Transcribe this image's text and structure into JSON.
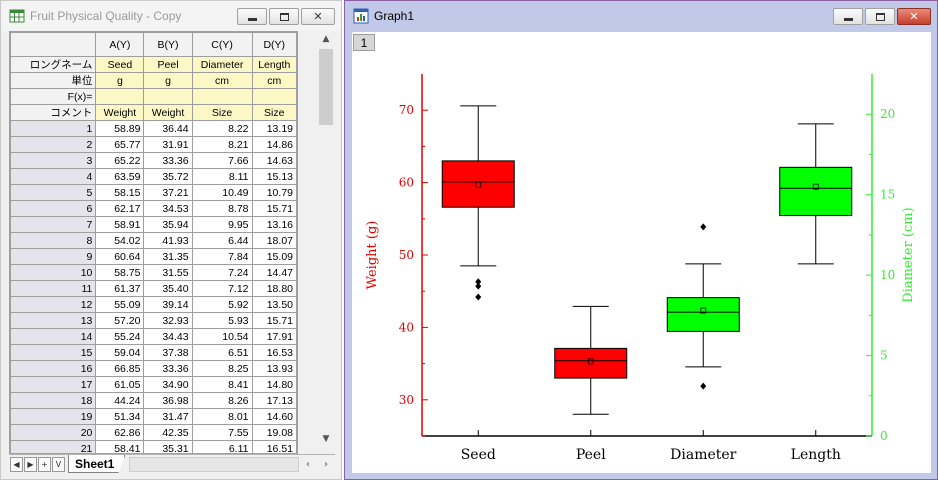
{
  "worksheet": {
    "title": "Fruit Physical Quality - Copy",
    "columns": [
      "A(Y)",
      "B(Y)",
      "C(Y)",
      "D(Y)"
    ],
    "meta_rows": [
      {
        "label": "ロングネーム",
        "values": [
          "Seed",
          "Peel",
          "Diameter",
          "Length"
        ]
      },
      {
        "label": "単位",
        "values": [
          "g",
          "g",
          "cm",
          "cm"
        ]
      },
      {
        "label": "F(x)=",
        "values": [
          "",
          "",
          "",
          ""
        ]
      },
      {
        "label": "コメント",
        "values": [
          "Weight",
          "Weight",
          "Size",
          "Size"
        ]
      }
    ],
    "rows": [
      [
        "1",
        "58.89",
        "36.44",
        "8.22",
        "13.19"
      ],
      [
        "2",
        "65.77",
        "31.91",
        "8.21",
        "14.86"
      ],
      [
        "3",
        "65.22",
        "33.36",
        "7.66",
        "14.63"
      ],
      [
        "4",
        "63.59",
        "35.72",
        "8.11",
        "15.13"
      ],
      [
        "5",
        "58.15",
        "37.21",
        "10.49",
        "10.79"
      ],
      [
        "6",
        "62.17",
        "34.53",
        "8.78",
        "15.71"
      ],
      [
        "7",
        "58.91",
        "35.94",
        "9.95",
        "13.16"
      ],
      [
        "8",
        "54.02",
        "41.93",
        "6.44",
        "18.07"
      ],
      [
        "9",
        "60.64",
        "31.35",
        "7.84",
        "15.09"
      ],
      [
        "10",
        "58.75",
        "31.55",
        "7.24",
        "14.47"
      ],
      [
        "11",
        "61.37",
        "35.40",
        "7.12",
        "18.80"
      ],
      [
        "12",
        "55.09",
        "39.14",
        "5.92",
        "13.50"
      ],
      [
        "13",
        "57.20",
        "32.93",
        "5.93",
        "15.71"
      ],
      [
        "14",
        "55.24",
        "34.43",
        "10.54",
        "17.91"
      ],
      [
        "15",
        "59.04",
        "37.38",
        "6.51",
        "16.53"
      ],
      [
        "16",
        "66.85",
        "33.36",
        "8.25",
        "13.93"
      ],
      [
        "17",
        "61.05",
        "34.90",
        "8.41",
        "14.80"
      ],
      [
        "18",
        "44.24",
        "36.98",
        "8.26",
        "17.13"
      ],
      [
        "19",
        "51.34",
        "31.47",
        "8.01",
        "14.60"
      ],
      [
        "20",
        "62.86",
        "42.35",
        "7.55",
        "19.08"
      ],
      [
        "21",
        "58.41",
        "35.31",
        "6.11",
        "16.51"
      ]
    ],
    "sheet_tab": "Sheet1"
  },
  "graph_window": {
    "title": "Graph1",
    "layer": "1"
  },
  "colors": {
    "left_axis": "#e00000",
    "right_axis": "#33ee33",
    "box_red": "#ff0000",
    "box_green": "#00ff00"
  },
  "chart_data": {
    "type": "box",
    "categories": [
      "Seed",
      "Peel",
      "Diameter",
      "Length"
    ],
    "left_axis": {
      "label": "Weight (g)",
      "ticks": [
        30,
        40,
        50,
        60,
        70
      ],
      "range": [
        25,
        75
      ]
    },
    "right_axis": {
      "label": "Diameter (cm)",
      "ticks": [
        0,
        5,
        10,
        15,
        20
      ],
      "range": [
        0,
        22.5
      ]
    },
    "boxes": [
      {
        "category": "Seed",
        "axis": "left",
        "color": "red",
        "whisker_low": 48.5,
        "q1": 56.6,
        "median": 60.1,
        "q3": 63.0,
        "whisker_high": 70.6,
        "mean": 59.7,
        "outliers": [
          46.3,
          45.7,
          44.2
        ]
      },
      {
        "category": "Peel",
        "axis": "left",
        "color": "red",
        "whisker_low": 28.0,
        "q1": 33.0,
        "median": 35.4,
        "q3": 37.1,
        "whisker_high": 42.9,
        "mean": 35.3,
        "outliers": []
      },
      {
        "category": "Diameter",
        "axis": "right",
        "color": "green",
        "whisker_low": 4.3,
        "q1": 6.5,
        "median": 7.7,
        "q3": 8.6,
        "whisker_high": 10.7,
        "mean": 7.8,
        "outliers": [
          13.0,
          3.1
        ]
      },
      {
        "category": "Length",
        "axis": "right",
        "color": "green",
        "whisker_low": 10.7,
        "q1": 13.7,
        "median": 15.4,
        "q3": 16.7,
        "whisker_high": 19.4,
        "mean": 15.5,
        "outliers": []
      }
    ]
  }
}
